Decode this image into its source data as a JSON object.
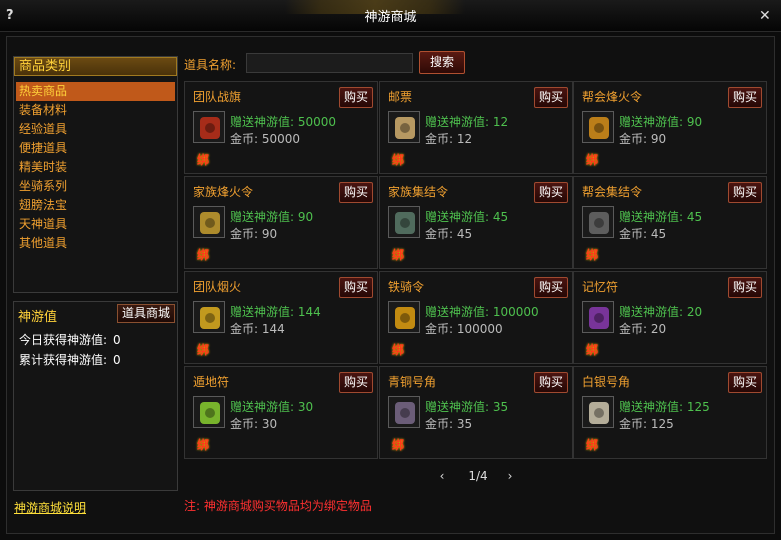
{
  "window": {
    "title": "神游商城",
    "help_glyph": "?",
    "close_glyph": "✕"
  },
  "categories": {
    "header": "商品类别",
    "items": [
      "热卖商品",
      "装备材料",
      "经验道具",
      "便捷道具",
      "精美时装",
      "坐骑系列",
      "翅膀法宝",
      "天神道具",
      "其他道具"
    ],
    "active_index": 0
  },
  "shen_you": {
    "title": "神游值",
    "shop_button": "道具商城",
    "today_label": "今日获得神游值:",
    "today_value": "0",
    "total_label": "累计获得神游值:",
    "total_value": "0"
  },
  "help_link": "神游商城说明",
  "search": {
    "label": "道具名称:",
    "value": "",
    "button": "搜索"
  },
  "products": [
    {
      "name": "团队战旗",
      "buy": "购买",
      "gift": "赠送神游值: 50000",
      "price": "金币: 50000",
      "bind": "绑",
      "icon": "flag-icon",
      "color": "#c0301a"
    },
    {
      "name": "邮票",
      "buy": "购买",
      "gift": "赠送神游值: 12",
      "price": "金币: 12",
      "bind": "绑",
      "icon": "stamp-icon",
      "color": "#d4b070"
    },
    {
      "name": "帮会烽火令",
      "buy": "购买",
      "gift": "赠送神游值: 90",
      "price": "金币: 90",
      "bind": "绑",
      "icon": "beacon-token-icon",
      "color": "#d8901a"
    },
    {
      "name": "家族烽火令",
      "buy": "购买",
      "gift": "赠送神游值: 90",
      "price": "金币: 90",
      "bind": "绑",
      "icon": "beacon-token-icon",
      "color": "#c8a030"
    },
    {
      "name": "家族集结令",
      "buy": "购买",
      "gift": "赠送神游值: 45",
      "price": "金币: 45",
      "bind": "绑",
      "icon": "rally-token-icon",
      "color": "#5a7a6a"
    },
    {
      "name": "帮会集结令",
      "buy": "购买",
      "gift": "赠送神游值: 45",
      "price": "金币: 45",
      "bind": "绑",
      "icon": "rally-token-icon",
      "color": "#6a6a6a"
    },
    {
      "name": "团队烟火",
      "buy": "购买",
      "gift": "赠送神游值: 144",
      "price": "金币: 144",
      "bind": "绑",
      "icon": "firework-icon",
      "color": "#e0b020"
    },
    {
      "name": "铁骑令",
      "buy": "购买",
      "gift": "赠送神游值: 100000",
      "price": "金币: 100000",
      "bind": "绑",
      "icon": "cavalry-token-icon",
      "color": "#e0a010"
    },
    {
      "name": "记忆符",
      "buy": "购买",
      "gift": "赠送神游值: 20",
      "price": "金币: 20",
      "bind": "绑",
      "icon": "memory-talisman-icon",
      "color": "#8a3ab0"
    },
    {
      "name": "遁地符",
      "buy": "购买",
      "gift": "赠送神游值: 30",
      "price": "金币: 30",
      "bind": "绑",
      "icon": "escape-talisman-icon",
      "color": "#8ad030"
    },
    {
      "name": "青铜号角",
      "buy": "购买",
      "gift": "赠送神游值: 35",
      "price": "金币: 35",
      "bind": "绑",
      "icon": "bronze-horn-icon",
      "color": "#7a6a8a"
    },
    {
      "name": "白银号角",
      "buy": "购买",
      "gift": "赠送神游值: 125",
      "price": "金币: 125",
      "bind": "绑",
      "icon": "silver-horn-icon",
      "color": "#d0c8b0"
    }
  ],
  "pager": {
    "prev": "‹",
    "page": "1/4",
    "next": "›"
  },
  "notice": "注: 神游商城购买物品均为绑定物品"
}
